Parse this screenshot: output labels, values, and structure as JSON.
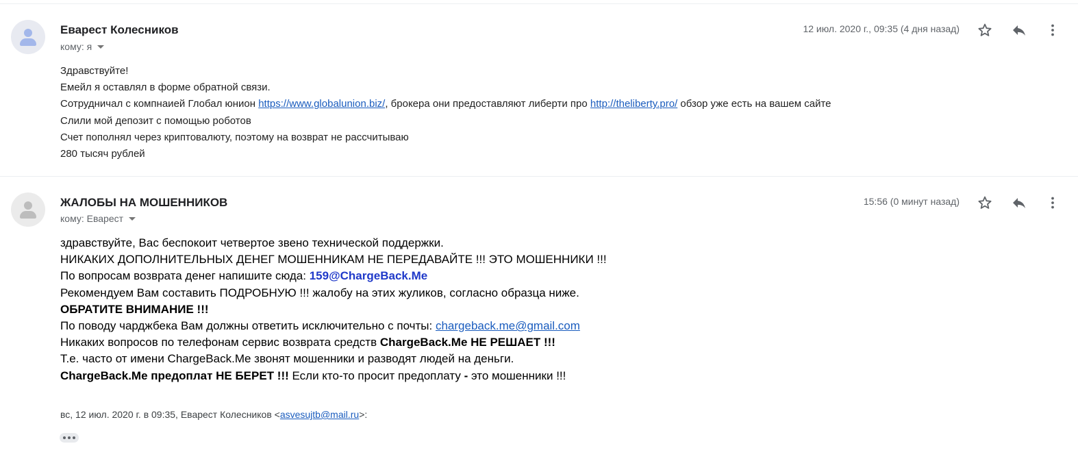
{
  "messages": [
    {
      "sender": "Еварест Колесников",
      "recipient": "кому: я",
      "date": "12 июл. 2020 г., 09:35 (4 дня назад)",
      "body": {
        "line1": "Здравствуйте!",
        "line2": "Емейл я оставлял в форме обратной связи.",
        "line3_a": "Сотрудничал с компнаией Глобал юнион ",
        "line3_link1": "https://www.globalunion.biz/",
        "line3_b": ", брокера они предоставляют либерти про ",
        "line3_link2": "http://theliberty.pro/",
        "line3_c": " обзор уже есть на вашем сайте",
        "line4": "Слили мой депозит с помощью роботов",
        "line5": "Счет пополнял через криптовалюту, поэтому на возврат не рассчитываю",
        "line6": "280 тысяч рублей"
      }
    },
    {
      "sender": "ЖАЛОБЫ НА МОШЕННИКОВ",
      "recipient": "кому: Еварест",
      "date": "15:56 (0 минут назад)",
      "body": {
        "line1": "здравствуйте, Вас беспокоит четвертое звено технической поддержки.",
        "line2": "НИКАКИХ ДОПОЛНИТЕЛЬНЫХ ДЕНЕГ МОШЕННИКАМ НЕ ПЕРЕДАВАЙТЕ !!! ЭТО МОШЕННИКИ !!!",
        "line3_a": "По вопросам возврата денег напишите сюда: ",
        "line3_email": "159@ChargeBack.Me",
        "line4": "Рекомендуем Вам составить ПОДРОБНУЮ !!! жалобу на этих жуликов, согласно образца ниже.",
        "line5": "ОБРАТИТЕ ВНИМАНИЕ !!!",
        "line6_a": "По поводу чарджбека Вам должны ответить исключительно с почты: ",
        "line6_email": "chargeback.me@gmail.com",
        "line7_a": "Никаких вопросов по телефонам сервис возврата средств ",
        "line7_b": "ChargeBack.Me НЕ РЕШАЕТ !!!",
        "line8": "Т.е. часто от имени ChargeBack.Me звонят мошенники и разводят людей на деньги.",
        "line9_a": "ChargeBack.Me предоплат НЕ БЕРЕТ !!!",
        "line9_b": " Если кто-то просит предоплату ",
        "line9_c": "-",
        "line9_d": " это мошенники !!!"
      },
      "quote": {
        "header_a": "вс, 12 июл. 2020 г. в 09:35, Еварест Колесников <",
        "header_email": "asvesujtb@mail.ru",
        "header_b": ">:"
      }
    }
  ],
  "icons": {
    "star": "star-icon",
    "reply": "reply-icon",
    "more": "more-vert-icon",
    "avatar": "person-icon",
    "expand": "ellipsis-icon"
  },
  "colors": {
    "link": "#1a5cbe",
    "highlight_email": "#1f39c9",
    "icon": "#5f6368"
  }
}
